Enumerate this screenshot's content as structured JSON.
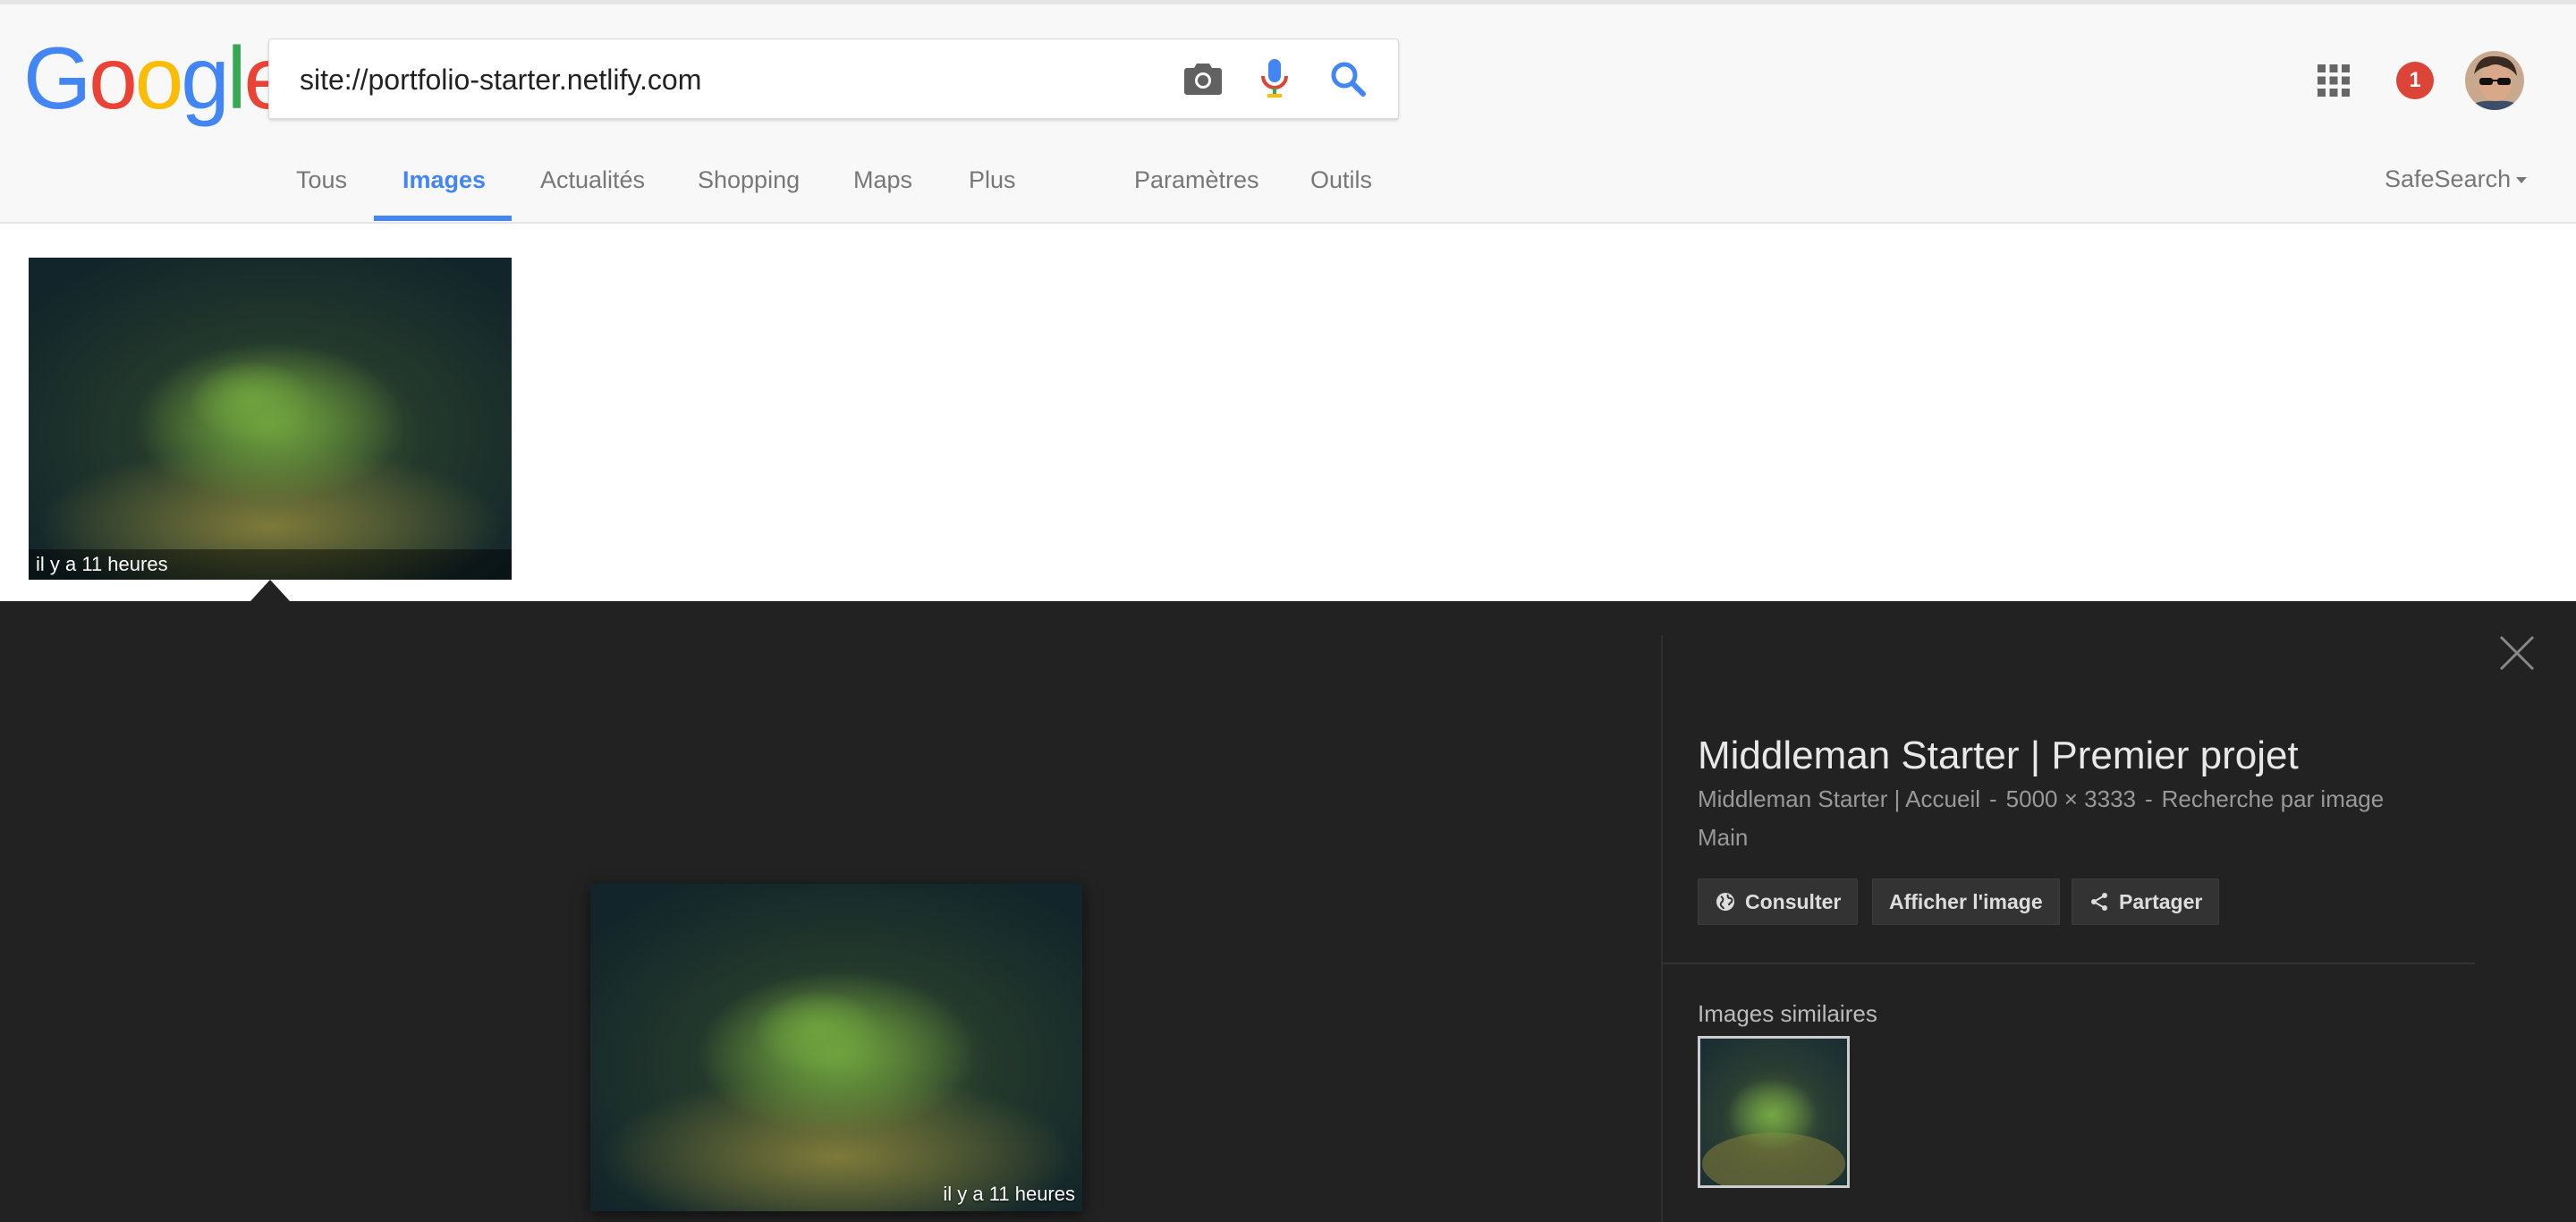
{
  "logo": {
    "letters": [
      "G",
      "o",
      "o",
      "g",
      "l",
      "e"
    ],
    "colors": [
      "#4285f4",
      "#ea4335",
      "#fbbc05",
      "#4285f4",
      "#34a853",
      "#ea4335"
    ]
  },
  "search": {
    "query": "site://portfolio-starter.netlify.com",
    "icons": [
      "camera-icon",
      "microphone-icon",
      "search-icon"
    ]
  },
  "header": {
    "notification_count": "1"
  },
  "tabs": [
    {
      "label": "Tous",
      "active": false
    },
    {
      "label": "Images",
      "active": true
    },
    {
      "label": "Actualités",
      "active": false
    },
    {
      "label": "Shopping",
      "active": false
    },
    {
      "label": "Maps",
      "active": false
    },
    {
      "label": "Plus",
      "active": false
    },
    {
      "label": "Paramètres",
      "active": false
    },
    {
      "label": "Outils",
      "active": false
    }
  ],
  "safesearch": {
    "label": "SafeSearch"
  },
  "results": [
    {
      "caption": "il y a 11 heures"
    }
  ],
  "panel": {
    "image_caption": "il y a 11 heures",
    "title": "Middleman Starter | Premier projet",
    "source": "Middleman Starter | Accueil",
    "separator": "-",
    "dimensions": "5000 × 3333",
    "search_by_image": "Recherche par image",
    "subtitle": "Main",
    "buttons": {
      "visit": "Consulter",
      "view_image": "Afficher l'image",
      "share": "Partager"
    },
    "similar_label": "Images similaires"
  },
  "colors": {
    "accent": "#4285f4",
    "panel_bg": "#222222",
    "badge": "#db4437"
  }
}
